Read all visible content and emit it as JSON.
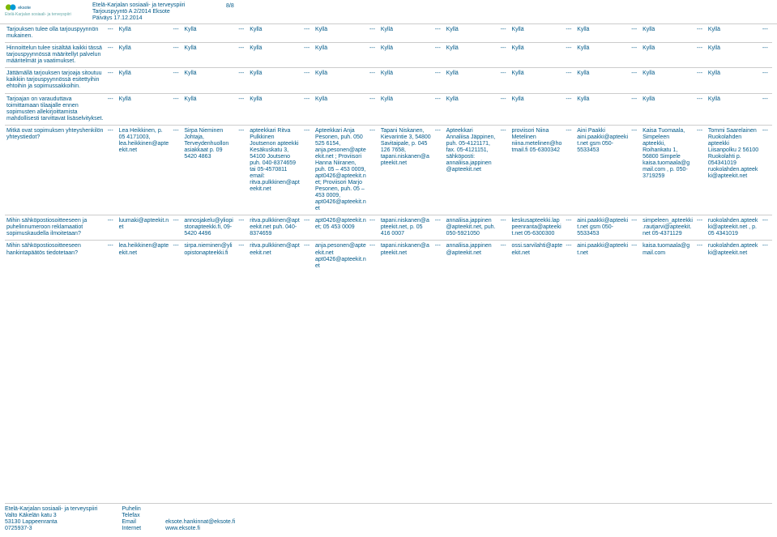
{
  "logo_sub": "Etelä-Karjalan sosiaali- ja terveyspiiri",
  "meta": {
    "line1": "Etelä-Karjalan sosiaali- ja terveyspiiri",
    "line2": "Tarjouspyyntö A 2/2014 Eksote",
    "line3": "Päiväys 17.12.2014"
  },
  "page_no": "8/8",
  "dash": "---",
  "kylla": "Kyllä",
  "rows": {
    "r1_label": "Tarjouksen tulee olla tarjouspyynnön mukainen.",
    "r2_label": "Hinnoittelun tulee sisältää kaikki tässä tarjouspyynnössä määritellyt palvelun määritelmät ja vaatimukset.",
    "r3_label": "Jättämällä tarjouksen tarjoaja sitoutuu kaikkiin tarjouspyynnössä esitettyihin ehtoihin ja sopimussakkoihin.",
    "r4_label": "Tarjoajan on varauduttava toimittamaan tilaajalle ennen sopimusten allekirjoittamista mahdollisesti tarvittavat lisäselvitykset.",
    "r5_label": "Mitkä ovat sopimuksen yhteyshenkilön yhteystiedot?",
    "r5_v1": "Lea Heikkinen, p. 05 4171003, lea.heikkinen@apteekit.net",
    "r5_v2": "Sirpa Nieminen Johtaja, Terveydenhuollon asiakkaat p. 09 5420 4863",
    "r5_v3": "apteekkari Ritva Pulkkinen Joutsenon apteekki Kesäkuskatu 3, 54100 Joutseno puh. 040-8374659 tai 05-4570811 email: ritva.pulkkinen@apteekit.net",
    "r5_v4": "Apteekkari Anja Pesonen, puh. 050 525 6154, anja.pesonen@apteekit.net ; Proviisori Hanna Niiranen, puh. 05 – 453 0009, apt0426@apteekit.net; Proviisori Marjo Pesonen, puh. 05 – 453 0009, apt0426@apteekit.net",
    "r5_v5": "Tapani Niskanen, Kievarintie 3, 54800 Savitaipale, p. 045 126 7658, tapani.niskanen@apteekit.net",
    "r5_v6": "Apteekkari Annaliisa Jäppinen, puh. 05-4121171, fax. 05-4121151, sähköposti: annaliisa.jappinen@apteekit.net",
    "r5_v7": "proviisori Niina Metelinen niina.metelinen@hotmail.fi 05-6300342",
    "r5_v8": "Aini Paakki aini.paakki@apteekit.net gsm 050-5533453",
    "r5_v9": "Kaisa Tuomaala, Simpeleen apteekki, Roihankatu 1, 56800 Simpele kaisa.tuomaala@gmail.com , p. 050-3719259",
    "r5_v10": "Tommi Saarelainen Ruokolahden apteekki Liisanpolku 2 56100 Ruokolahti p. 054341019 ruokolahden.apteekki@apteekit.net",
    "r6_label": "Mihin sähköpostiosoitteeseen ja puhelinnumeroon reklamaatiot sopimuskaudella ilmoitetaan?",
    "r6_v1": "luumaki@apteekit.net",
    "r6_v2": "annosjakelu@yliopistonapteekki.fi, 09-5420 4496",
    "r6_v3": "ritva.pulkkinen@apteekit.net puh. 040-8374659",
    "r6_v4": "apt0426@apteekit.net; 05 453 0009",
    "r6_v5": "tapani.niskanen@apteekit.net, p. 05 416 0007",
    "r6_v6": "annaliisa.jappinen@apteekit.net, puh. 050-5921050",
    "r6_v7": "keskusapteekki.lappeenranta@apteekit.net  05-6300300",
    "r6_v8": "aini.paakki@apteekit.net gsm 050-5533453",
    "r6_v9": "simpeleen_apteekki.rautjarvi@apteekit.net 05-4371129",
    "r6_v10": "ruokolahden.apteekki@apteekit.net , p. 05 4341019",
    "r7_label": "Mihin sähköpostiosoitteeseen hankintapäätös tiedotetaan?",
    "r7_v1": "lea.heikkinen@apteekit.net",
    "r7_v2": "sirpa.nieminen@yliopistonapteekki.fi",
    "r7_v3": "ritva.pulkkinen@apteekit.net",
    "r7_v4": "anja.pesonen@apteekit.net apt0426@apteekit.net",
    "r7_v5": "tapani.niskanen@apteekit.net",
    "r7_v6": "annaliisa.jappinen@apteekit.net",
    "r7_v7": "ossi.sarvilahti@apteekit.net",
    "r7_v8": "aini.paakki@apteekit.net",
    "r7_v9": "kaisa.tuomaala@gmail.com",
    "r7_v10": "ruokolahden.apteekki@apteekit.net"
  },
  "footer": {
    "addr1": "Etelä-Karjalan sosiaali- ja terveyspiiri",
    "addr2": "Valto Käkelän katu 3",
    "addr3": "53130 Lappeenranta",
    "addr4": "0725937-3",
    "c2_1": "Puhelin",
    "c2_2": "Telefax",
    "c2_3": "Email",
    "c2_4": "Internet",
    "c3_3": "eksote.hankinnat@eksote.fi",
    "c3_4": "www.eksote.fi"
  }
}
